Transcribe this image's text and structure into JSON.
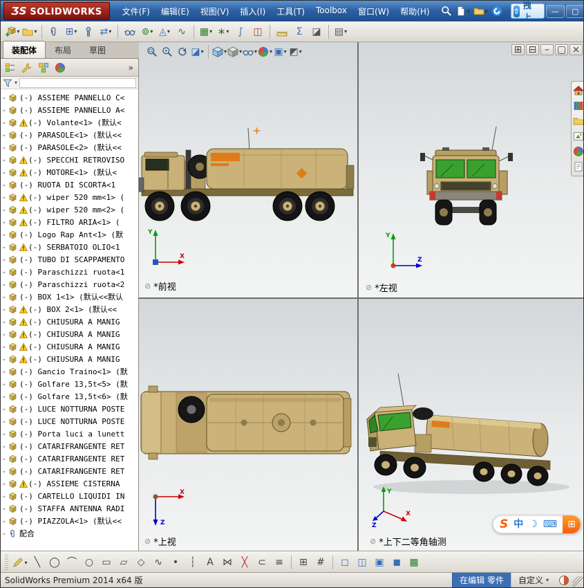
{
  "titlebar": {
    "logo_mark": "ƷS",
    "logo_text": "SOLIDWORKS",
    "menus": [
      {
        "name": "menu-file",
        "label": "文件(F)"
      },
      {
        "name": "menu-edit",
        "label": "编辑(E)"
      },
      {
        "name": "menu-view",
        "label": "视图(V)"
      },
      {
        "name": "menu-insert",
        "label": "插入(I)"
      },
      {
        "name": "menu-tools",
        "label": "工具(T)"
      },
      {
        "name": "menu-toolbox",
        "label": "Toolbox"
      },
      {
        "name": "menu-window",
        "label": "窗口(W)"
      },
      {
        "name": "menu-help",
        "label": "帮助(H)"
      }
    ],
    "quick": [
      {
        "name": "search",
        "svg": "magWhite"
      },
      {
        "name": "new-document",
        "svg": "page",
        "caret": true
      },
      {
        "name": "open-document",
        "svg": "folder",
        "caret": true
      },
      {
        "name": "sogou-browser",
        "svg": "swirl"
      }
    ],
    "upload_label": "拖拽上传",
    "window_buttons": [
      {
        "name": "minimize-window",
        "glyph": "—"
      },
      {
        "name": "maximize-window",
        "glyph": "▢"
      },
      {
        "name": "close-window",
        "glyph": "×"
      }
    ]
  },
  "main_toolbar": [
    {
      "name": "insert-components",
      "svg": "partAdd",
      "caret": true
    },
    {
      "name": "open-part",
      "svg": "folder",
      "caret": true
    },
    {
      "sep": true
    },
    {
      "name": "mate",
      "svg": "clip"
    },
    {
      "name": "linear-component-pattern",
      "glyph": "⊞",
      "color": "#3a6fb5",
      "caret": true
    },
    {
      "name": "smart-fasteners",
      "svg": "bolt"
    },
    {
      "name": "move-component",
      "glyph": "⇄",
      "color": "#3a6fb5",
      "caret": true
    },
    {
      "sep": true
    },
    {
      "name": "show-hidden-components",
      "svg": "glasses"
    },
    {
      "name": "assembly-features",
      "glyph": "⊚",
      "color": "#2a7a2a",
      "caret": true
    },
    {
      "name": "reference-geometry",
      "glyph": "◬",
      "color": "#3a6fb5",
      "caret": true
    },
    {
      "name": "new-motion-study",
      "glyph": "∿",
      "color": "#2a7a2a"
    },
    {
      "sep": true
    },
    {
      "name": "bill-of-materials",
      "glyph": "▦",
      "color": "#2a7a2a",
      "caret": true
    },
    {
      "name": "exploded-view",
      "glyph": "∗",
      "color": "#2a7a2a",
      "caret": true
    },
    {
      "name": "explode-line-sketch",
      "glyph": "∫",
      "color": "#3a6fb5"
    },
    {
      "name": "interference-detection",
      "glyph": "◫",
      "color": "#b03a2e"
    },
    {
      "sep": true
    },
    {
      "name": "measure",
      "svg": "ruler"
    },
    {
      "name": "mass-properties",
      "glyph": "Σ",
      "color": "#3a6fb5"
    },
    {
      "name": "section-properties",
      "glyph": "◪",
      "color": "#555555"
    },
    {
      "sep": true
    },
    {
      "name": "simulation-advisor",
      "glyph": "▤",
      "color": "#555555",
      "caret": true
    }
  ],
  "tabs": [
    {
      "name": "tab-assembly",
      "label": "装配体",
      "active": true
    },
    {
      "name": "tab-layout",
      "label": "布局",
      "active": false
    },
    {
      "name": "tab-sketch",
      "label": "草图",
      "active": false
    }
  ],
  "panel": {
    "overflow": "»",
    "tabs": [
      {
        "name": "featuremanager-tab",
        "svg": "treeTab"
      },
      {
        "name": "propertymanager-tab",
        "svg": "wrench"
      },
      {
        "name": "configurationmanager-tab",
        "svg": "configTab"
      },
      {
        "name": "displaymanager-tab",
        "svg": "ball"
      }
    ]
  },
  "tree": [
    {
      "warn": false,
      "text": "(-) ASSIEME PANNELLO C<"
    },
    {
      "warn": false,
      "text": "(-) ASSIEME PANNELLO A<"
    },
    {
      "warn": true,
      "text": "(-) Volante<1> (默认<"
    },
    {
      "warn": false,
      "text": "(-) PARASOLE<1> (默认<<"
    },
    {
      "warn": false,
      "text": "(-) PARASOLE<2> (默认<<"
    },
    {
      "warn": true,
      "text": "(-) SPECCHI RETROVISO"
    },
    {
      "warn": true,
      "text": "(-) MOTORE<1> (默认<"
    },
    {
      "warn": false,
      "text": "(-) RUOTA DI SCORTA<1"
    },
    {
      "warn": true,
      "text": "(-) wiper 520 mm<1> ("
    },
    {
      "warn": true,
      "text": "(-) wiper 520 mm<2> ("
    },
    {
      "warn": true,
      "text": "(-) FILTRO ARIA<1> ("
    },
    {
      "warn": false,
      "text": "(-) Logo Rap Ant<1> (默"
    },
    {
      "warn": true,
      "text": "(-) SERBATOIO OLIO<1"
    },
    {
      "warn": false,
      "text": "(-) TUBO DI SCAPPAMENTO"
    },
    {
      "warn": false,
      "text": "(-) Paraschizzi ruota<1"
    },
    {
      "warn": false,
      "text": "(-) Paraschizzi ruota<2"
    },
    {
      "warn": false,
      "text": "(-) BOX 1<1> (默认<<默认"
    },
    {
      "warn": true,
      "text": "(-) BOX 2<1> (默认<<"
    },
    {
      "warn": true,
      "text": "(-) CHIUSURA A MANIG"
    },
    {
      "warn": true,
      "text": "(-) CHIUSURA A MANIG"
    },
    {
      "warn": true,
      "text": "(-) CHIUSURA A MANIG"
    },
    {
      "warn": true,
      "text": "(-) CHIUSURA A MANIG"
    },
    {
      "warn": false,
      "text": "(-) Gancio Traino<1> (默"
    },
    {
      "warn": false,
      "text": "(-) Golfare 13,5t<5> (默"
    },
    {
      "warn": false,
      "text": "(-) Golfare 13,5t<6> (默"
    },
    {
      "warn": false,
      "text": "(-) LUCE NOTTURNA POSTE"
    },
    {
      "warn": false,
      "text": "(-) LUCE NOTTURNA POSTE"
    },
    {
      "warn": false,
      "text": "(-) Porta luci a lunett"
    },
    {
      "warn": false,
      "text": "(-) CATARIFRANGENTE RET"
    },
    {
      "warn": false,
      "text": "(-) CATARIFRANGENTE RET"
    },
    {
      "warn": false,
      "text": "(-) CATARIFRANGENTE RET"
    },
    {
      "warn": true,
      "text": "(-) ASSIEME CISTERNA"
    },
    {
      "warn": false,
      "text": "(-) CARTELLO LIQUIDI IN"
    },
    {
      "warn": false,
      "text": "(-) STAFFA ANTENNA RADI"
    },
    {
      "warn": false,
      "text": "(-) PIAZZOLA<1> (默认<<"
    },
    {
      "mates": true,
      "text": "配合"
    }
  ],
  "hud_toolbar": [
    {
      "name": "zoom-to-fit",
      "svg": "magFit"
    },
    {
      "name": "zoom-to-area",
      "svg": "magPlus"
    },
    {
      "name": "previous-view",
      "svg": "prevView"
    },
    {
      "name": "section-view",
      "glyph": "◪",
      "color": "#3a6fb5",
      "caret": true
    },
    {
      "sep": true
    },
    {
      "name": "view-orientation",
      "svg": "cube",
      "caret": true
    },
    {
      "name": "display-style",
      "svg": "cubeShaded",
      "caret": true
    },
    {
      "name": "hide-show-items",
      "svg": "glasses",
      "caret": true
    },
    {
      "name": "edit-appearance",
      "svg": "ball",
      "caret": true
    },
    {
      "name": "apply-scene",
      "glyph": "▣",
      "color": "#3a6fb5",
      "caret": true
    },
    {
      "name": "view-settings",
      "glyph": "◩",
      "color": "#555555",
      "caret": true
    }
  ],
  "doc_buttons": [
    {
      "name": "tile-windows",
      "glyph": "⊞"
    },
    {
      "name": "split-view",
      "glyph": "⊟"
    },
    {
      "name": "minimize-document",
      "glyph": "–"
    },
    {
      "name": "restore-document",
      "glyph": "▢"
    },
    {
      "name": "close-document",
      "glyph": "×"
    }
  ],
  "taskpane": [
    {
      "name": "solidworks-resources",
      "svg": "home"
    },
    {
      "name": "design-library",
      "svg": "library"
    },
    {
      "name": "file-explorer",
      "svg": "folder"
    },
    {
      "name": "view-palette",
      "svg": "palette"
    },
    {
      "name": "appearances-scenes",
      "svg": "ball"
    },
    {
      "name": "custom-properties",
      "svg": "propsPage"
    }
  ],
  "viewports": [
    {
      "label": "*前视",
      "axes": {
        "v": "Y",
        "h": "X"
      }
    },
    {
      "label": "*左视",
      "axes": {
        "v": "Y",
        "h": "Z"
      }
    },
    {
      "label": "*上视",
      "axes": {
        "h": "X",
        "d": "Z"
      }
    },
    {
      "label": "*上下二等角轴测",
      "axes": {
        "v": "Y",
        "r": "X",
        "l": "Z"
      }
    }
  ],
  "bottom_toolbar": [
    {
      "name": "sketch",
      "svg": "pencil",
      "caret": true
    },
    {
      "name": "line",
      "glyph": "╲",
      "color": "#444444"
    },
    {
      "name": "circle",
      "glyph": "◯",
      "color": "#444444"
    },
    {
      "name": "arc",
      "glyph": "⌒",
      "color": "#444444"
    },
    {
      "name": "ellipse",
      "glyph": "○",
      "color": "#444444"
    },
    {
      "name": "rectangle",
      "glyph": "▭",
      "color": "#444444"
    },
    {
      "name": "slot",
      "glyph": "▱",
      "color": "#444444"
    },
    {
      "name": "polygon",
      "glyph": "◇",
      "color": "#444444"
    },
    {
      "name": "spline",
      "glyph": "∿",
      "color": "#444444"
    },
    {
      "name": "point",
      "glyph": "•",
      "color": "#444444"
    },
    {
      "name": "centerline",
      "glyph": "┆",
      "color": "#444444"
    },
    {
      "name": "text",
      "glyph": "A",
      "color": "#444444"
    },
    {
      "name": "mirror-entities",
      "glyph": "⋈",
      "color": "#444444"
    },
    {
      "name": "trim-entities",
      "glyph": "╳",
      "color": "#b03a2e"
    },
    {
      "name": "convert-entities",
      "glyph": "⊂",
      "color": "#444444"
    },
    {
      "name": "offset-entities",
      "glyph": "≡",
      "color": "#444444"
    },
    {
      "sep": true
    },
    {
      "name": "grid-snap",
      "glyph": "⊞",
      "color": "#444444"
    },
    {
      "name": "snap-options",
      "glyph": "#",
      "color": "#444444"
    },
    {
      "sep": true
    },
    {
      "name": "wireframe-display",
      "glyph": "◻",
      "color": "#3a6fb5"
    },
    {
      "name": "hidden-lines-display",
      "glyph": "◫",
      "color": "#3a6fb5"
    },
    {
      "name": "shaded-with-edges-display",
      "glyph": "▣",
      "color": "#3a6fb5"
    },
    {
      "name": "shaded-display",
      "glyph": "◼",
      "color": "#3a6fb5"
    },
    {
      "name": "design-table",
      "glyph": "▦",
      "color": "#2a7a2a"
    }
  ],
  "statusbar": {
    "product": "SolidWorks Premium 2014 x64 版",
    "editing": "在编辑 零件",
    "custom": "自定义"
  },
  "ime_items": [
    {
      "name": "sogou-logo",
      "glyph": "S",
      "color": "#f4600c"
    },
    {
      "name": "ime-language",
      "glyph": "中",
      "color": "#2b7bd4"
    },
    {
      "name": "ime-moon",
      "glyph": "☽",
      "color": "#2b7bd4"
    },
    {
      "name": "ime-keyboard",
      "glyph": "⌨",
      "color": "#2b7bd4"
    },
    {
      "name": "ime-toolbox",
      "glyph": "⊞",
      "color": "#ffffff"
    }
  ],
  "colors": {
    "titlebar_blue": "#2e62a4",
    "logo_red": "#9e1b13",
    "truck_tan": "#c9b177",
    "hazard_orange": "#e07b1a",
    "windshield_green": "#3aa12f",
    "status_edit_blue": "#3a6fb5"
  }
}
